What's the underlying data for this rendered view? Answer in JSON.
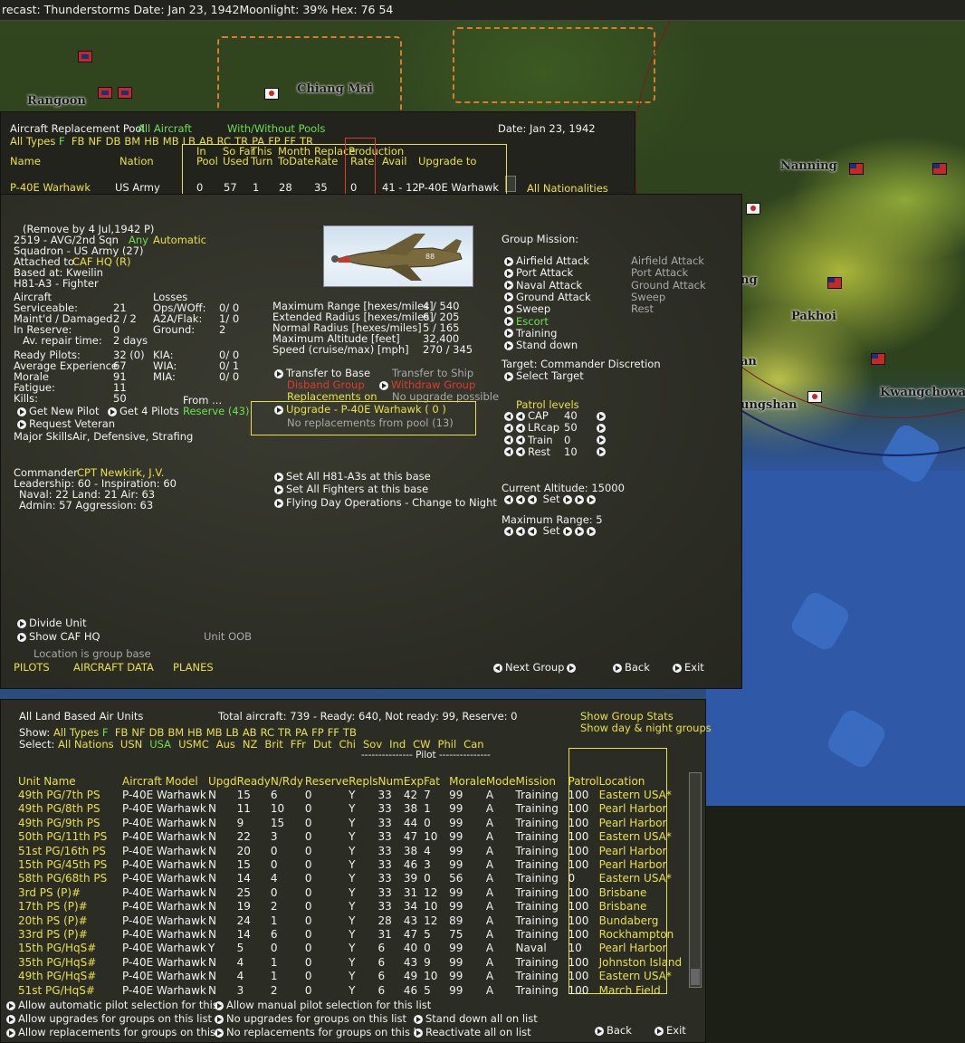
{
  "topbar": {
    "text": "recast: Thunderstorms Date:  Jan 23, 1942Moonlight: 39%  Hex: 76  54"
  },
  "map": {
    "cities": [
      "Rangoon",
      "Chiang Mai",
      "Nanning",
      "Pakhoi",
      "Kwangchowan",
      "ungshan",
      "ng",
      "an"
    ]
  },
  "pool": {
    "title": "Aircraft Replacement Pool",
    "filter_all": "All Aircraft",
    "filter_pools": "With/Without Pools",
    "date": "Date:  Jan 23, 1942",
    "types_label": "All Types",
    "types_f": "F",
    "types": [
      "FB",
      "NF",
      "DB",
      "BM",
      "HB",
      "MB",
      "LB",
      "AB",
      "RC",
      "TR",
      "PA",
      "FP",
      "FF",
      "TR"
    ],
    "headers_top": [
      "In",
      "So Far",
      "This",
      "Month",
      "Replace",
      "Production"
    ],
    "headers": [
      "Name",
      "Nation",
      "Pool",
      "Used",
      "Turn",
      "ToDate",
      "Rate",
      "Rate",
      "Avail",
      "Upgrade to"
    ],
    "row": {
      "name": "P-40E Warhawk",
      "nation": "US Army",
      "pool": "0",
      "used": "57",
      "turn": "1",
      "todate": "28",
      "rate": "35",
      "prod": "0",
      "avail": "41 - 12",
      "upgrade": "P-40E Warhawk"
    },
    "all_nationalities": "All Nationalities"
  },
  "unit": {
    "remove_by": "(Remove by  4 Jul,1942   P)",
    "group": "2519 - AVG/2nd Sqn",
    "any": "Any",
    "automatic": "Automatic",
    "squadron": "Squadron - US Army (27)",
    "attached_label": "Attached to",
    "attached": "CAF HQ (R)",
    "based": "Based at:  Kweilin",
    "aircraft_type": "H81-A3 - Fighter",
    "aircraft_label": "Aircraft",
    "losses_label": "Losses",
    "serviceable": "Serviceable:",
    "serviceable_v": "21",
    "ops_label": "Ops/WOff:",
    "ops_v": "0/ 0",
    "maint": "Maint'd / Damaged",
    "maint_v": "2 / 2",
    "a2a": "A2A/Flak:",
    "a2a_v": "1/ 0",
    "reserve": "In Reserve:",
    "reserve_v": "0",
    "ground": "Ground:",
    "ground_v": "2",
    "repair": "Av. repair time:",
    "repair_v": "2 days",
    "ready": "Ready Pilots:",
    "ready_v": "32 (0)",
    "kia": "KIA:",
    "kia_v": "0/ 0",
    "exp": "Average Experience",
    "exp_v": "67",
    "wia": "WIA:",
    "wia_v": "0/ 1",
    "morale": "Morale",
    "morale_v": "91",
    "mia": "MIA:",
    "mia_v": "0/ 0",
    "fatigue": "Fatigue:",
    "fatigue_v": "11",
    "kills": "Kills:",
    "kills_v": "50",
    "from": "From ...",
    "get_new_pilot": "Get New Pilot",
    "get_4_pilots": "Get 4 Pilots",
    "reserve_43": "Reserve (43)",
    "request_veteran": "Request Veteran",
    "major_skills": "Major SkillsAir, Defensive, Strafing",
    "commander_label": "Commander",
    "commander": "CPT Newkirk, J.V.",
    "leadership": "Leadership: 60 - Inspiration: 60",
    "naval": "Naval:  22   Land:  21   Air:  63",
    "admin": "Admin:  57   Aggression:  63",
    "stats": [
      [
        "Maximum Range [hexes/miles]",
        "4 / 540"
      ],
      [
        "Extended Radius [hexes/miles]",
        "6 / 205"
      ],
      [
        "Normal Radius [hexes/miles]",
        "5 / 165"
      ],
      [
        "Maximum Altitude [feet]",
        "32,400"
      ],
      [
        "Speed (cruise/max) [mph]",
        "270 / 345"
      ]
    ],
    "transfer_base": "Transfer to Base",
    "transfer_ship": "Transfer to Ship",
    "disband": "Disband Group",
    "withdraw": "Withdraw Group",
    "repl_on": "Replacements on",
    "no_upgrade": "No upgrade possible",
    "upgrade": "Upgrade - P-40E Warhawk  ( 0 )",
    "no_repl": "No replacements from pool (13)",
    "set_all_h81": "Set All H81-A3s at this base",
    "set_all_fighters": "Set All Fighters at this base",
    "flying_day": "Flying Day Operations - Change to Night",
    "mission_label": "Group Mission:",
    "missions": [
      "Airfield Attack",
      "Port Attack",
      "Naval Attack",
      "Ground Attack",
      "Sweep",
      "Escort",
      "Training",
      "Stand down"
    ],
    "missions_right": [
      "Airfield Attack",
      "Port Attack",
      "Ground Attack",
      "Sweep",
      "Rest"
    ],
    "target": "Target: Commander Discretion",
    "select_target": "Select Target",
    "patrol_label": "Patrol levels",
    "patrol": [
      [
        "CAP",
        "40"
      ],
      [
        "LRcap",
        "50"
      ],
      [
        "Train",
        "0"
      ],
      [
        "Rest",
        "10"
      ]
    ],
    "altitude": "Current Altitude:  15000",
    "set": "Set",
    "max_range": "Maximum Range:  5",
    "divide": "Divide Unit",
    "show_caf": "Show CAF HQ",
    "unit_oob": "Unit OOB",
    "location_base": "Location is group base",
    "tabs": [
      "PILOTS",
      "AIRCRAFT DATA",
      "PLANES"
    ],
    "next_group": "Next Group",
    "back": "Back",
    "exit": "Exit"
  },
  "list": {
    "title": "All Land Based Air Units",
    "totals": "Total aircraft:  739 - Ready:  640, Not ready:  99, Reserve:  0",
    "show_stats": "Show Group Stats",
    "show_day_night": "Show day & night groups",
    "show_label": "Show:",
    "all_types": "All Types",
    "types_f": "F",
    "types": [
      "FB",
      "NF",
      "DB",
      "BM",
      "HB",
      "MB",
      "LB",
      "AB",
      "RC",
      "TR",
      "PA",
      "FP",
      "FF",
      "TB"
    ],
    "select_label": "Select:",
    "all_nations": "All Nations",
    "nations": [
      "USN",
      "USA",
      "USMC",
      "Aus",
      "NZ",
      "Brit",
      "FFr",
      "Dut",
      "Chi",
      "Sov",
      "Ind",
      "CW",
      "Phil",
      "Can"
    ],
    "pilot_sep": "--------------- Pilot ---------------",
    "headers": [
      "Unit Name",
      "Aircraft Model",
      "Upgd",
      "Ready",
      "N/Rdy",
      "Reserve",
      "Repls",
      "Num",
      "Exp",
      "Fat",
      "Morale",
      "Mode",
      "Mission",
      "Patrol",
      "Location"
    ],
    "rows": [
      [
        "49th PG/7th PS",
        "P-40E Warhawk",
        "N",
        "15",
        "6",
        "0",
        "Y",
        "33",
        "42",
        "7",
        "99",
        "A",
        "Training",
        "100",
        "Eastern USA*"
      ],
      [
        "49th PG/8th PS",
        "P-40E Warhawk",
        "N",
        "11",
        "10",
        "0",
        "Y",
        "33",
        "38",
        "1",
        "99",
        "A",
        "Training",
        "100",
        "Pearl Harbor"
      ],
      [
        "49th PG/9th PS",
        "P-40E Warhawk",
        "N",
        "9",
        "15",
        "0",
        "Y",
        "33",
        "44",
        "0",
        "99",
        "A",
        "Training",
        "100",
        "Pearl Harbor"
      ],
      [
        "50th PG/11th PS",
        "P-40E Warhawk",
        "N",
        "22",
        "3",
        "0",
        "Y",
        "33",
        "47",
        "10",
        "99",
        "A",
        "Training",
        "100",
        "Eastern USA*"
      ],
      [
        "51st PG/16th PS",
        "P-40E Warhawk",
        "N",
        "20",
        "0",
        "0",
        "Y",
        "33",
        "38",
        "4",
        "99",
        "A",
        "Training",
        "100",
        "Pearl Harbor"
      ],
      [
        "15th PG/45th PS",
        "P-40E Warhawk",
        "N",
        "15",
        "0",
        "0",
        "Y",
        "33",
        "46",
        "3",
        "99",
        "A",
        "Training",
        "100",
        "Pearl Harbor"
      ],
      [
        "58th PG/68th PS",
        "P-40E Warhawk",
        "N",
        "14",
        "4",
        "0",
        "Y",
        "33",
        "39",
        "0",
        "56",
        "A",
        "Training",
        "0",
        "Eastern USA*"
      ],
      [
        "3rd PS (P)#",
        "P-40E Warhawk",
        "N",
        "25",
        "0",
        "0",
        "Y",
        "33",
        "31",
        "12",
        "99",
        "A",
        "Training",
        "100",
        "Brisbane"
      ],
      [
        "17th PS (P)#",
        "P-40E Warhawk",
        "N",
        "19",
        "2",
        "0",
        "Y",
        "33",
        "34",
        "10",
        "99",
        "A",
        "Training",
        "100",
        "Brisbane"
      ],
      [
        "20th PS (P)#",
        "P-40E Warhawk",
        "N",
        "24",
        "1",
        "0",
        "Y",
        "28",
        "43",
        "12",
        "89",
        "A",
        "Training",
        "100",
        "Bundaberg"
      ],
      [
        "33rd PS (P)#",
        "P-40E Warhawk",
        "N",
        "14",
        "6",
        "0",
        "Y",
        "31",
        "47",
        "5",
        "75",
        "A",
        "Training",
        "100",
        "Rockhampton"
      ],
      [
        "15th PG/HqS#",
        "P-40E Warhawk",
        "Y",
        "5",
        "0",
        "0",
        "Y",
        "6",
        "40",
        "0",
        "99",
        "A",
        "Naval",
        "10",
        "Pearl Harbor"
      ],
      [
        "35th PG/HqS#",
        "P-40E Warhawk",
        "N",
        "4",
        "1",
        "0",
        "Y",
        "6",
        "43",
        "9",
        "99",
        "A",
        "Training",
        "100",
        "Johnston Island"
      ],
      [
        "49th PG/HqS#",
        "P-40E Warhawk",
        "N",
        "4",
        "1",
        "0",
        "Y",
        "6",
        "49",
        "10",
        "99",
        "A",
        "Training",
        "100",
        "Eastern USA*"
      ],
      [
        "51st PG/HqS#",
        "P-40E Warhawk",
        "N",
        "3",
        "2",
        "0",
        "Y",
        "6",
        "46",
        "5",
        "99",
        "A",
        "Training",
        "100",
        "March Field"
      ]
    ],
    "footer": [
      [
        "Allow automatic pilot selection for this",
        "Allow manual pilot selection for this list",
        ""
      ],
      [
        "Allow upgrades for groups on this list",
        "No upgrades for groups on this list",
        "Stand down all on list"
      ],
      [
        "Allow replacements for groups on this",
        "No replacements for groups on this l",
        "Reactivate all on list"
      ]
    ],
    "back": "Back",
    "exit": "Exit"
  }
}
